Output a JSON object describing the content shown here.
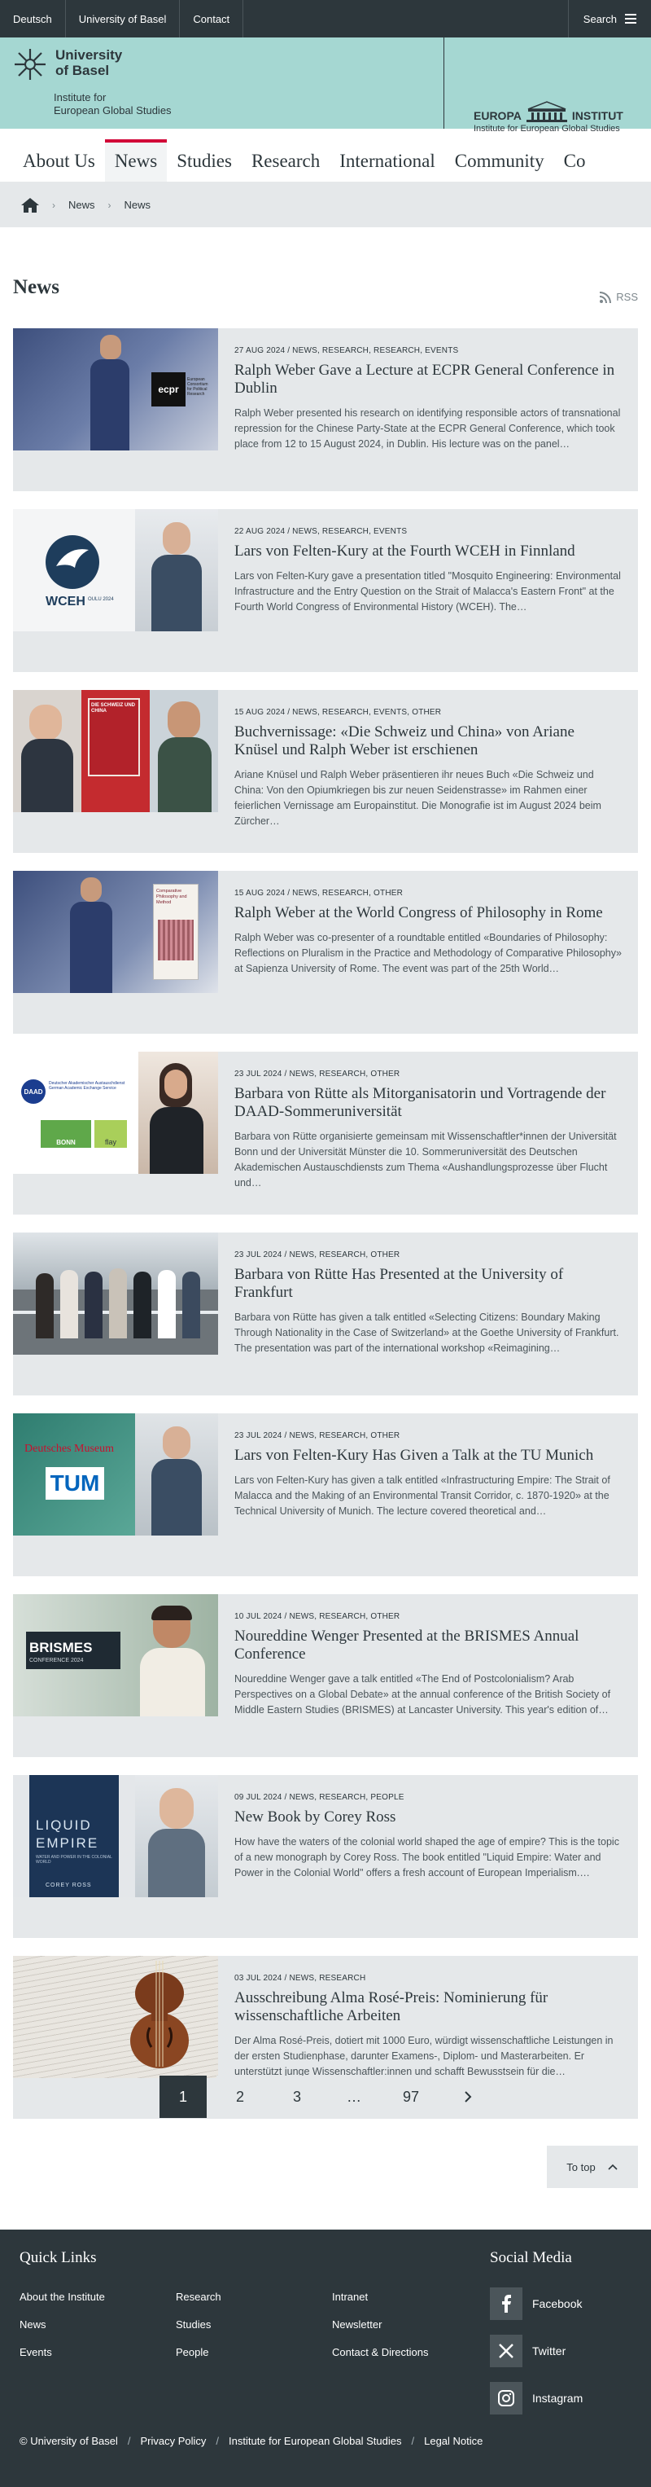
{
  "topbar": {
    "links": [
      "Deutsch",
      "University of Basel",
      "Contact"
    ],
    "search_label": "Search"
  },
  "brand": {
    "uni_line1": "University",
    "uni_line2": "of Basel",
    "institute_line1": "Institute for",
    "institute_line2": "European Global Studies",
    "europa_word1": "EUROPA",
    "europa_word2": "INSTITUT",
    "europa_sub": "Institute for European Global Studies"
  },
  "nav": {
    "items": [
      "About Us",
      "News",
      "Studies",
      "Research",
      "International",
      "Community",
      "Co"
    ]
  },
  "breadcrumb": {
    "home_icon": "home-icon",
    "items": [
      "News",
      "News"
    ]
  },
  "page": {
    "title": "News",
    "rss_label": "RSS"
  },
  "news": [
    {
      "meta": "27 AUG 2024 / NEWS, RESEARCH, RESEARCH, EVENTS",
      "title": "Ralph Weber Gave a Lecture at ECPR General Conference in Dublin",
      "teaser": "Ralph Weber presented his research on identifying responsible actors of transnational repression for the Chinese Party-State at the ECPR General Conference, which took place from 12 to 15 August 2024, in Dublin. His lecture was on the panel…"
    },
    {
      "meta": "22 AUG 2024 / NEWS, RESEARCH, EVENTS",
      "title": "Lars von Felten-Kury at the Fourth WCEH in Finnland",
      "teaser": "Lars von Felten-Kury gave a presentation titled \"Mosquito Engineering: Environmental Infrastructure and the Entry Question on the Strait of Malacca's Eastern Front\" at the Fourth World Congress of Environmental History (WCEH). The…"
    },
    {
      "meta": "15 AUG 2024 / NEWS, RESEARCH, EVENTS, OTHER",
      "title": "Buchvernissage: «Die Schweiz und China» von Ariane Knüsel und Ralph Weber ist erschienen",
      "teaser": "Ariane Knüsel und Ralph Weber präsentieren ihr neues Buch «Die Schweiz und China: Von den Opiumkriegen bis zur neuen Seidenstrasse» im Rahmen einer feierlichen Vernissage am Europainstitut. Die Monografie ist im August 2024 beim Zürcher…"
    },
    {
      "meta": "15 AUG 2024 / NEWS, RESEARCH, OTHER",
      "title": "Ralph Weber at the World Congress of Philosophy in Rome",
      "teaser": "Ralph Weber was co-presenter of a roundtable entitled «Boundaries of Philosophy: Reflections on Pluralism in the Practice and Methodology of Comparative Philosophy» at Sapienza University of Rome. The event was part of the 25th World…"
    },
    {
      "meta": "23 JUL 2024 / NEWS, RESEARCH, OTHER",
      "title": "Barbara von Rütte als Mitorganisatorin und Vortragende der DAAD-Sommeruniversität",
      "teaser": "Barbara von Rütte organisierte gemeinsam mit Wissenschaftler*innen der Universität Bonn und der Universität Münster die 10. Sommeruniversität des Deutschen Akademischen Austauschdiensts zum Thema «Aushandlungsprozesse über Flucht und…"
    },
    {
      "meta": "23 JUL 2024 / NEWS, RESEARCH, OTHER",
      "title": "Barbara von Rütte Has Presented at the University of Frankfurt",
      "teaser": "Barbara von Rütte has given a talk entitled «Selecting Citizens: Boundary Making Through Nationality in the Case of Switzerland» at the Goethe University of Frankfurt. The presentation was part of the international workshop «Reimagining…"
    },
    {
      "meta": "23 JUL 2024 / NEWS, RESEARCH, OTHER",
      "title": "Lars von Felten-Kury Has Given a Talk at the TU Munich",
      "teaser": "Lars von Felten-Kury has given a talk entitled «Infrastructuring Empire: The Strait of Malacca and the Making of an Environmental Transit Corridor, c. 1870-1920» at the Technical University of Munich. The lecture covered theoretical and…"
    },
    {
      "meta": "10 JUL 2024 / NEWS, RESEARCH, OTHER",
      "title": "Noureddine Wenger Presented at the BRISMES Annual Conference",
      "teaser": "Noureddine Wenger gave a talk entitled «The End of Postcolonialism? Arab Perspectives on a Global Debate» at the annual conference of the British Society of Middle Eastern Studies (BRISMES) at Lancaster University. This year's edition of…"
    },
    {
      "meta": "09 JUL 2024 / NEWS, RESEARCH, PEOPLE",
      "title": "New Book by Corey Ross",
      "teaser": "How have the waters of the colonial world shaped the age of empire? This is the topic of a new monograph by Corey Ross. The book entitled \"Liquid Empire: Water and Power in the Colonial World\" offers a fresh account of European Imperialism.…"
    },
    {
      "meta": "03 JUL 2024 / NEWS, RESEARCH",
      "title": "Ausschreibung Alma Rosé-Preis: Nominierung für wissenschaftliche Arbeiten",
      "teaser": "Der Alma Rosé-Preis, dotiert mit 1000 Euro, würdigt wissenschaftliche Leistungen in der ersten Studienphase, darunter Examens-, Diplom- und Masterarbeiten. Er unterstützt junge Wissenschaftler:innen und schafft Bewusstsein für die…"
    }
  ],
  "thumb_text": {
    "ecpr": "ecpr",
    "ecpr_sub1": "European",
    "ecpr_sub2": "Consortium",
    "ecpr_sub3": "for Political",
    "ecpr_sub4": "Research",
    "wceh": "WCEH",
    "wceh_sub": "OULU 2024",
    "book_cover": "DIE SCHWEIZ UND CHINA",
    "phil_cover": "Comparative Philosophy and Method",
    "daad": "DAAD",
    "daad_sub": "Deutscher Akademischer Austauschdienst",
    "daad_sub2": "German Academic Exchange Service",
    "bonn": "BONN",
    "flay": "flay",
    "museum": "Deutsches Museum",
    "tum": "TUM",
    "brismes": "BRISMES",
    "brismes_sub": "CONFERENCE 2024",
    "liquid": "LIQUID",
    "empire": "EMPIRE",
    "liquid_sub": "WATER AND POWER IN THE COLONIAL WORLD",
    "corey": "COREY ROSS"
  },
  "pagination": {
    "pages": [
      "1",
      "2",
      "3",
      "…",
      "97"
    ],
    "next_icon": "chevron-right-icon"
  },
  "to_top": {
    "label": "To top"
  },
  "footer": {
    "quick_links_title": "Quick Links",
    "col1": [
      "About the Institute",
      "News",
      "Events"
    ],
    "col2": [
      "Research",
      "Studies",
      "People"
    ],
    "col3": [
      "Intranet",
      "Newsletter",
      "Contact & Directions"
    ],
    "social_title": "Social Media",
    "social": [
      "Facebook",
      "Twitter",
      "Instagram"
    ],
    "legal": [
      "© University of Basel",
      "Privacy Policy",
      "Institute for European Global Studies",
      "Legal Notice"
    ]
  },
  "colors": {
    "dark": "#2d373c",
    "mint": "#a5d7d2",
    "light": "#e5e8ea",
    "accent": "#d20537"
  }
}
